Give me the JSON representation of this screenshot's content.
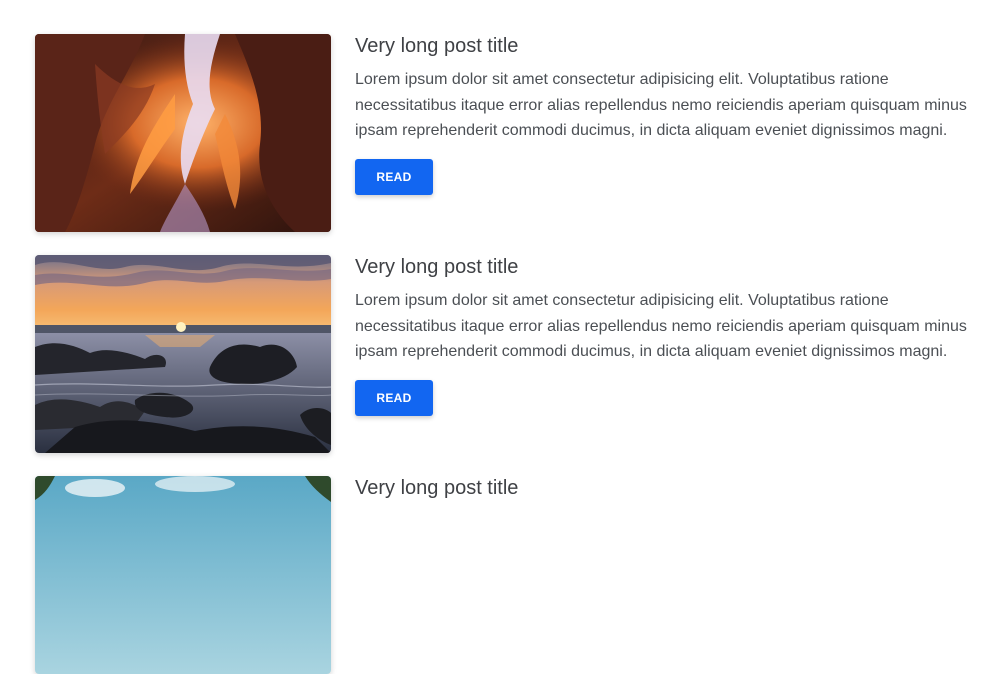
{
  "posts": [
    {
      "title": "Very long post title",
      "excerpt": "Lorem ipsum dolor sit amet consectetur adipisicing elit. Voluptatibus ratione necessitatibus itaque error alias repellendus nemo reiciendis aperiam quisquam minus ipsam reprehenderit commodi ducimus, in dicta aliquam eveniet dignissimos magni.",
      "button_label": "READ",
      "image": "canyon-photo"
    },
    {
      "title": "Very long post title",
      "excerpt": "Lorem ipsum dolor sit amet consectetur adipisicing elit. Voluptatibus ratione necessitatibus itaque error alias repellendus nemo reiciendis aperiam quisquam minus ipsam reprehenderit commodi ducimus, in dicta aliquam eveniet dignissimos magni.",
      "button_label": "READ",
      "image": "sunset-sea-photo"
    },
    {
      "title": "Very long post title",
      "image": "trees-sky-photo"
    }
  ],
  "colors": {
    "button": "#1266f1",
    "title": "#3f4145",
    "text": "#4b4f54"
  }
}
